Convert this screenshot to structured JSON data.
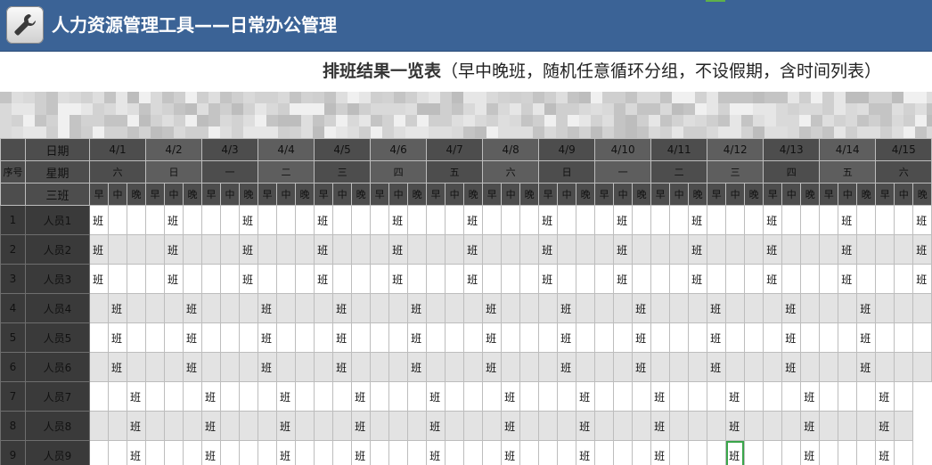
{
  "app": {
    "title": "人力资源管理工具——日常办公管理",
    "icon": "wrench-icon"
  },
  "subtitle": {
    "main": "排班结果一览表",
    "note": "（早中晚班，随机任意循环分组，不设假期，含时间列表）"
  },
  "table": {
    "labels": {
      "date": "日期",
      "weekday": "星期",
      "shift_group": "三班",
      "seq": "序号"
    },
    "dates": [
      "4/1",
      "4/2",
      "4/3",
      "4/4",
      "4/5",
      "4/6",
      "4/7",
      "4/8",
      "4/9",
      "4/10",
      "4/11",
      "4/12",
      "4/13",
      "4/14",
      "4/15"
    ],
    "weekdays": [
      "六",
      "日",
      "一",
      "二",
      "三",
      "四",
      "五",
      "六",
      "日",
      "一",
      "二",
      "三",
      "四",
      "五",
      "六"
    ],
    "shifts": [
      "早",
      "中",
      "晚"
    ],
    "mark": "班",
    "rows": [
      {
        "no": "1",
        "name": "人员1",
        "cells": [
          "班",
          "",
          "",
          "",
          "班",
          "",
          "",
          "",
          "班",
          "",
          "",
          "",
          "班",
          "",
          "",
          "",
          "班",
          "",
          "",
          "",
          "班",
          "",
          "",
          "",
          "班",
          "",
          "",
          "",
          "班",
          "",
          "",
          "",
          "班",
          "",
          "",
          "",
          "班",
          "",
          "",
          "",
          "班",
          "",
          "",
          "",
          "班"
        ]
      },
      {
        "no": "2",
        "name": "人员2",
        "cells": [
          "班",
          "",
          "",
          "",
          "班",
          "",
          "",
          "",
          "班",
          "",
          "",
          "",
          "班",
          "",
          "",
          "",
          "班",
          "",
          "",
          "",
          "班",
          "",
          "",
          "",
          "班",
          "",
          "",
          "",
          "班",
          "",
          "",
          "",
          "班",
          "",
          "",
          "",
          "班",
          "",
          "",
          "",
          "班",
          "",
          "",
          "",
          "班"
        ]
      },
      {
        "no": "3",
        "name": "人员3",
        "cells": [
          "班",
          "",
          "",
          "",
          "班",
          "",
          "",
          "",
          "班",
          "",
          "",
          "",
          "班",
          "",
          "",
          "",
          "班",
          "",
          "",
          "",
          "班",
          "",
          "",
          "",
          "班",
          "",
          "",
          "",
          "班",
          "",
          "",
          "",
          "班",
          "",
          "",
          "",
          "班",
          "",
          "",
          "",
          "班",
          "",
          "",
          "",
          "班"
        ]
      },
      {
        "no": "4",
        "name": "人员4",
        "cells": [
          "",
          "班",
          "",
          "",
          "",
          "班",
          "",
          "",
          "",
          "班",
          "",
          "",
          "",
          "班",
          "",
          "",
          "",
          "班",
          "",
          "",
          "",
          "班",
          "",
          "",
          "",
          "班",
          "",
          "",
          "",
          "班",
          "",
          "",
          "",
          "班",
          "",
          "",
          "",
          "班",
          "",
          "",
          "",
          "班",
          "",
          "",
          ""
        ]
      },
      {
        "no": "5",
        "name": "人员5",
        "cells": [
          "",
          "班",
          "",
          "",
          "",
          "班",
          "",
          "",
          "",
          "班",
          "",
          "",
          "",
          "班",
          "",
          "",
          "",
          "班",
          "",
          "",
          "",
          "班",
          "",
          "",
          "",
          "班",
          "",
          "",
          "",
          "班",
          "",
          "",
          "",
          "班",
          "",
          "",
          "",
          "班",
          "",
          "",
          "",
          "班",
          "",
          "",
          ""
        ]
      },
      {
        "no": "6",
        "name": "人员6",
        "cells": [
          "",
          "班",
          "",
          "",
          "",
          "班",
          "",
          "",
          "",
          "班",
          "",
          "",
          "",
          "班",
          "",
          "",
          "",
          "班",
          "",
          "",
          "",
          "班",
          "",
          "",
          "",
          "班",
          "",
          "",
          "",
          "班",
          "",
          "",
          "",
          "班",
          "",
          "",
          "",
          "班",
          "",
          "",
          "",
          "班",
          "",
          "",
          ""
        ]
      },
      {
        "no": "7",
        "name": "人员7",
        "cells": [
          "",
          "",
          "班",
          "",
          "",
          "",
          "班",
          "",
          "",
          "",
          "班",
          "",
          "",
          "",
          "班",
          "",
          "",
          "",
          "班",
          "",
          "",
          "",
          "班",
          "",
          "",
          "",
          "班",
          "",
          "",
          "",
          "班",
          "",
          "",
          "",
          "班",
          "",
          "",
          "",
          "班",
          "",
          "",
          "",
          "班",
          ""
        ]
      },
      {
        "no": "8",
        "name": "人员8",
        "cells": [
          "",
          "",
          "班",
          "",
          "",
          "",
          "班",
          "",
          "",
          "",
          "班",
          "",
          "",
          "",
          "班",
          "",
          "",
          "",
          "班",
          "",
          "",
          "",
          "班",
          "",
          "",
          "",
          "班",
          "",
          "",
          "",
          "班",
          "",
          "",
          "",
          "班",
          "",
          "",
          "",
          "班",
          "",
          "",
          "",
          "班",
          ""
        ]
      },
      {
        "no": "9",
        "name": "人员9",
        "cells": [
          "",
          "",
          "班",
          "",
          "",
          "",
          "班",
          "",
          "",
          "",
          "班",
          "",
          "",
          "",
          "班",
          "",
          "",
          "",
          "班",
          "",
          "",
          "",
          "班",
          "",
          "",
          "",
          "班",
          "",
          "",
          "",
          "班",
          "",
          "",
          "",
          "班",
          "",
          "",
          "",
          "班",
          "",
          "",
          "",
          "班",
          ""
        ]
      }
    ],
    "selected": {
      "row": 9,
      "col": 34
    }
  },
  "colors": {
    "header_blue": "#3b6396",
    "header_grey": "#4d4d4d",
    "row_alt": "#e3e3e3",
    "selection": "#3aa54a"
  }
}
